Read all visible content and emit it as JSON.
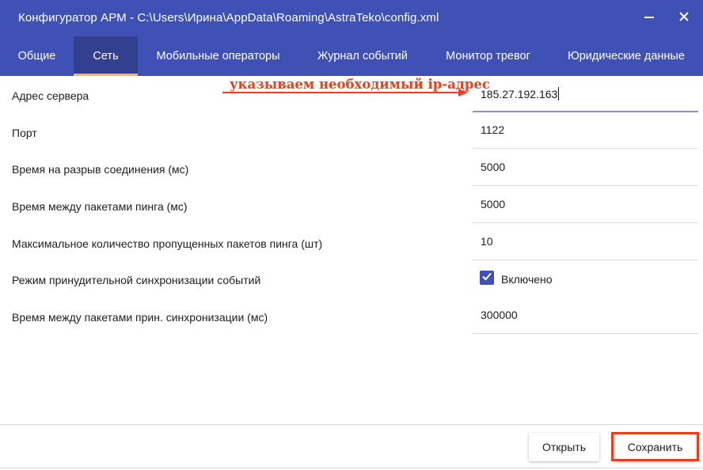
{
  "window": {
    "title": "Конфигуратор АРМ - C:\\Users\\Ирина\\AppData\\Roaming\\AstraTeko\\config.xml"
  },
  "tabs": [
    {
      "label": "Общие"
    },
    {
      "label": "Сеть"
    },
    {
      "label": "Мобильные операторы"
    },
    {
      "label": "Журнал событий"
    },
    {
      "label": "Монитор тревог"
    },
    {
      "label": "Юридические данные"
    }
  ],
  "active_tab": "Сеть",
  "settings": [
    {
      "label": "Адрес сервера",
      "value": "185.27.192.163"
    },
    {
      "label": "Порт",
      "value": "1122"
    },
    {
      "label": "Время на разрыв соединения (мс)",
      "value": "5000"
    },
    {
      "label": "Время между пакетами пинга (мс)",
      "value": "5000"
    },
    {
      "label": "Максимальное количество пропущенных пакетов пинга (шт)",
      "value": "10"
    },
    {
      "label": "Режим принудительной синхронизации событий",
      "checkbox_label": "Включено",
      "checked": true
    },
    {
      "label": "Время между пакетами прин. синхронизации (мс)",
      "value": "300000"
    }
  ],
  "annotation": {
    "text": "указываем необходимый ip-адрес",
    "color": "#e8401c"
  },
  "buttons": {
    "open": "Открыть",
    "save": "Сохранить"
  },
  "colors": {
    "primary": "#3f51b5",
    "active_tab_bg": "#32408f",
    "tab_indicator": "#ffb74d",
    "highlight": "#e8401c"
  },
  "icons": [
    "minimize-icon",
    "close-icon",
    "checkmark-icon",
    "arrow-right-icon"
  ]
}
